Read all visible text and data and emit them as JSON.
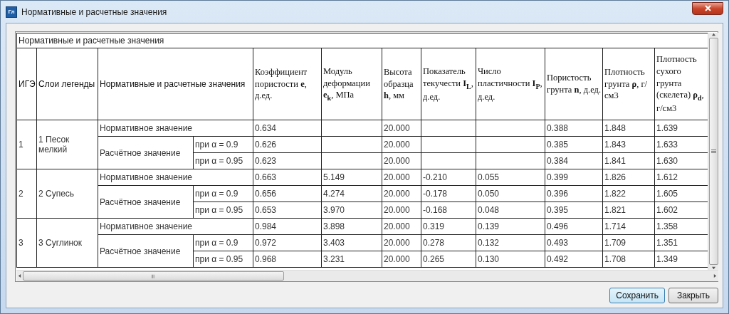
{
  "window": {
    "title": "Нормативные и расчетные значения",
    "icon_text": "Гл"
  },
  "table": {
    "caption": "Нормативные и расчетные значения",
    "columns": [
      {
        "kind": "label",
        "text": "ИГЭ"
      },
      {
        "kind": "label",
        "text": "Слои легенды"
      },
      {
        "kind": "label",
        "text": "Нормативные и расчетные значения"
      },
      {
        "kind": "quantity",
        "text": "Коэффициент пористости **e**, д.ед."
      },
      {
        "kind": "quantity",
        "text": "Модуль деформации **e**$_{k}$, МПа"
      },
      {
        "kind": "quantity",
        "text": "Высота образца **h**, мм"
      },
      {
        "kind": "quantity",
        "text": "Показатель текучести **I**$_{L}$, д.ед."
      },
      {
        "kind": "quantity",
        "text": "Число пластичности **I**$_{P}$, д.ед."
      },
      {
        "kind": "quantity",
        "text": "Пористость грунта **n**, д.ед."
      },
      {
        "kind": "quantity",
        "text": "Плотность грунта **ρ**, г/см3"
      },
      {
        "kind": "quantity",
        "text": "Плотность сухого грунта (скелета) **ρ**$_{d}$, г/см3"
      }
    ],
    "groups": [
      {
        "ige": "1",
        "layer": "1 Песок мелкий",
        "normative": {
          "label": "Нормативное значение",
          "values": {
            "e": "0.634",
            "h": "20.000",
            "n": "0.388",
            "rho": "1.848",
            "rho_d": "1.639"
          }
        },
        "design": {
          "label": "Расчётное значение",
          "rows": [
            {
              "alpha": "при α = 0.9",
              "values": {
                "e": "0.626",
                "h": "20.000",
                "n": "0.385",
                "rho": "1.843",
                "rho_d": "1.633"
              }
            },
            {
              "alpha": "при α = 0.95",
              "values": {
                "e": "0.623",
                "h": "20.000",
                "n": "0.384",
                "rho": "1.841",
                "rho_d": "1.630"
              }
            }
          ]
        }
      },
      {
        "ige": "2",
        "layer": "2 Супесь",
        "normative": {
          "label": "Нормативное значение",
          "values": {
            "e": "0.663",
            "e_k": "5.149",
            "h": "20.000",
            "I_L": "-0.210",
            "I_P": "0.055",
            "n": "0.399",
            "rho": "1.826",
            "rho_d": "1.612"
          }
        },
        "design": {
          "label": "Расчётное значение",
          "rows": [
            {
              "alpha": "при α = 0.9",
              "values": {
                "e": "0.656",
                "e_k": "4.274",
                "h": "20.000",
                "I_L": "-0.178",
                "I_P": "0.050",
                "n": "0.396",
                "rho": "1.822",
                "rho_d": "1.605"
              }
            },
            {
              "alpha": "при α = 0.95",
              "values": {
                "e": "0.653",
                "e_k": "3.970",
                "h": "20.000",
                "I_L": "-0.168",
                "I_P": "0.048",
                "n": "0.395",
                "rho": "1.821",
                "rho_d": "1.602"
              }
            }
          ]
        }
      },
      {
        "ige": "3",
        "layer": "3 Суглинок",
        "normative": {
          "label": "Нормативное значение",
          "values": {
            "e": "0.984",
            "e_k": "3.898",
            "h": "20.000",
            "I_L": "0.319",
            "I_P": "0.139",
            "n": "0.496",
            "rho": "1.714",
            "rho_d": "1.358"
          }
        },
        "design": {
          "label": "Расчётное значение",
          "rows": [
            {
              "alpha": "при α = 0.9",
              "values": {
                "e": "0.972",
                "e_k": "3.403",
                "h": "20.000",
                "I_L": "0.278",
                "I_P": "0.132",
                "n": "0.493",
                "rho": "1.709",
                "rho_d": "1.351"
              }
            },
            {
              "alpha": "при α = 0.95",
              "values": {
                "e": "0.968",
                "e_k": "3.231",
                "h": "20.000",
                "I_L": "0.265",
                "I_P": "0.130",
                "n": "0.492",
                "rho": "1.708",
                "rho_d": "1.349"
              }
            }
          ]
        }
      }
    ]
  },
  "buttons": [
    {
      "label": "Сохранить",
      "default": true
    },
    {
      "label": "Закрыть",
      "default": false
    }
  ]
}
